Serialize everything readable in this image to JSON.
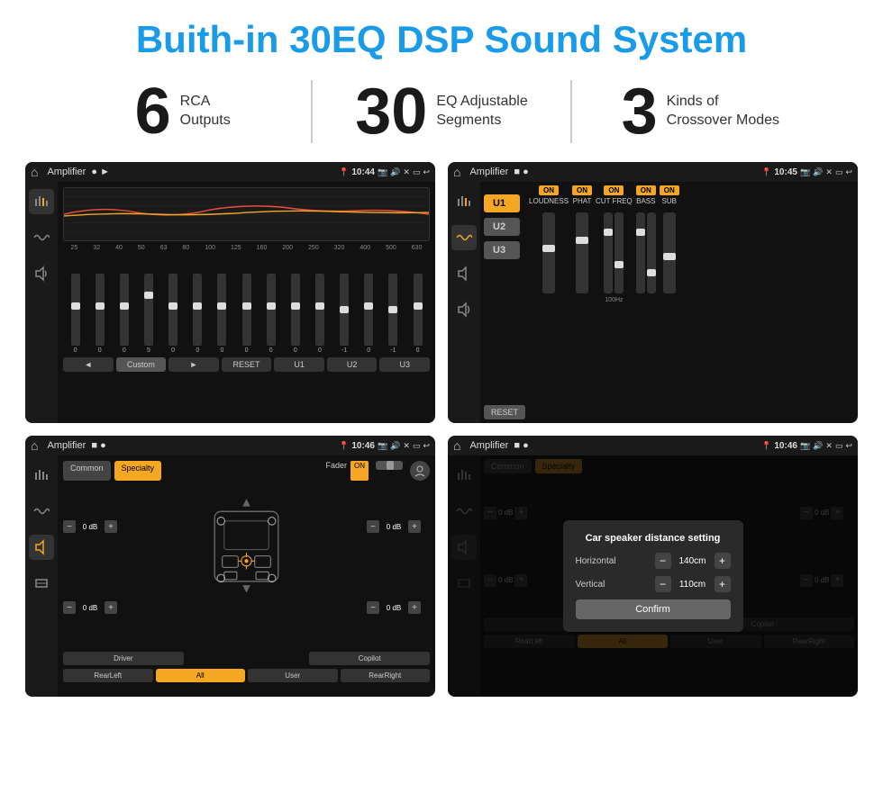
{
  "title": "Buith-in 30EQ DSP Sound System",
  "stats": [
    {
      "number": "6",
      "text1": "RCA",
      "text2": "Outputs"
    },
    {
      "number": "30",
      "text1": "EQ Adjustable",
      "text2": "Segments"
    },
    {
      "number": "3",
      "text1": "Kinds of",
      "text2": "Crossover Modes"
    }
  ],
  "screens": [
    {
      "id": "screen1",
      "statusbar": {
        "title": "Amplifier",
        "time": "10:44",
        "dots": [
          "gray",
          "gray"
        ]
      },
      "type": "eq"
    },
    {
      "id": "screen2",
      "statusbar": {
        "title": "Amplifier",
        "time": "10:45",
        "dots": [
          "gray",
          "orange"
        ]
      },
      "type": "crossover"
    },
    {
      "id": "screen3",
      "statusbar": {
        "title": "Amplifier",
        "time": "10:46",
        "dots": [
          "gray",
          "gray"
        ]
      },
      "type": "speaker"
    },
    {
      "id": "screen4",
      "statusbar": {
        "title": "Amplifier",
        "time": "10:46",
        "dots": [
          "gray",
          "gray"
        ]
      },
      "type": "dialog"
    }
  ],
  "eq": {
    "frequencies": [
      "25",
      "32",
      "40",
      "50",
      "63",
      "80",
      "100",
      "125",
      "160",
      "200",
      "250",
      "320",
      "400",
      "500",
      "630"
    ],
    "values": [
      "0",
      "0",
      "0",
      "5",
      "0",
      "0",
      "0",
      "0",
      "0",
      "0",
      "0",
      "-1",
      "0",
      "-1"
    ],
    "buttons": [
      "◄",
      "Custom",
      "►",
      "RESET",
      "U1",
      "U2",
      "U3"
    ]
  },
  "crossover": {
    "u_buttons": [
      "U1",
      "U2",
      "U3"
    ],
    "controls": [
      "LOUDNESS",
      "PHAT",
      "CUT FREQ",
      "BASS",
      "SUB"
    ],
    "reset_label": "RESET"
  },
  "speaker": {
    "tabs": [
      "Common",
      "Specialty"
    ],
    "fader_label": "Fader",
    "fader_on": "ON",
    "volumes": [
      "0 dB",
      "0 dB",
      "0 dB",
      "0 dB"
    ],
    "bottom_buttons": [
      "Driver",
      "",
      "Copilot",
      "RearLeft",
      "All",
      "User",
      "RearRight"
    ]
  },
  "dialog": {
    "title": "Car speaker distance setting",
    "horizontal_label": "Horizontal",
    "horizontal_value": "140cm",
    "vertical_label": "Vertical",
    "vertical_value": "110cm",
    "confirm_label": "Confirm"
  }
}
